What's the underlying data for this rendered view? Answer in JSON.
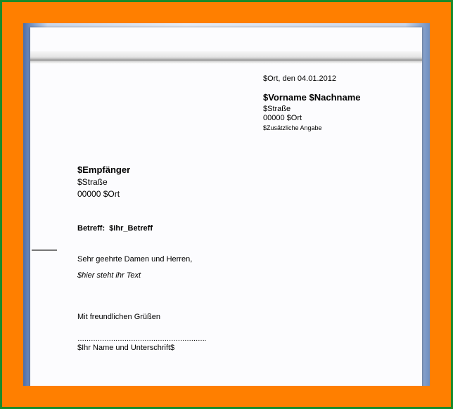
{
  "sender": {
    "date_line": "$Ort, den 04.01.2012",
    "name": "$Vorname $Nachname",
    "street": "$Straße",
    "city": "00000 $Ort",
    "extra": "$Zusätzliche Angabe"
  },
  "recipient": {
    "name": "$Empfänger",
    "street": "$Straße",
    "city": "00000 $Ort"
  },
  "subject": {
    "label": "Betreff:",
    "value": "$Ihr_Betreff"
  },
  "body": {
    "salutation": "Sehr geehrte Damen und Herren,",
    "text": "$hier steht ihr Text"
  },
  "closing": {
    "greeting": "Mit freundlichen Grüßen",
    "signature_line": "………………………………………………….",
    "signature": "$Ihr Name und Unterschrift$"
  },
  "colors": {
    "outer_border": "#1c8a2a",
    "frame": "#ff7f00",
    "background": "#8aa5cf"
  }
}
